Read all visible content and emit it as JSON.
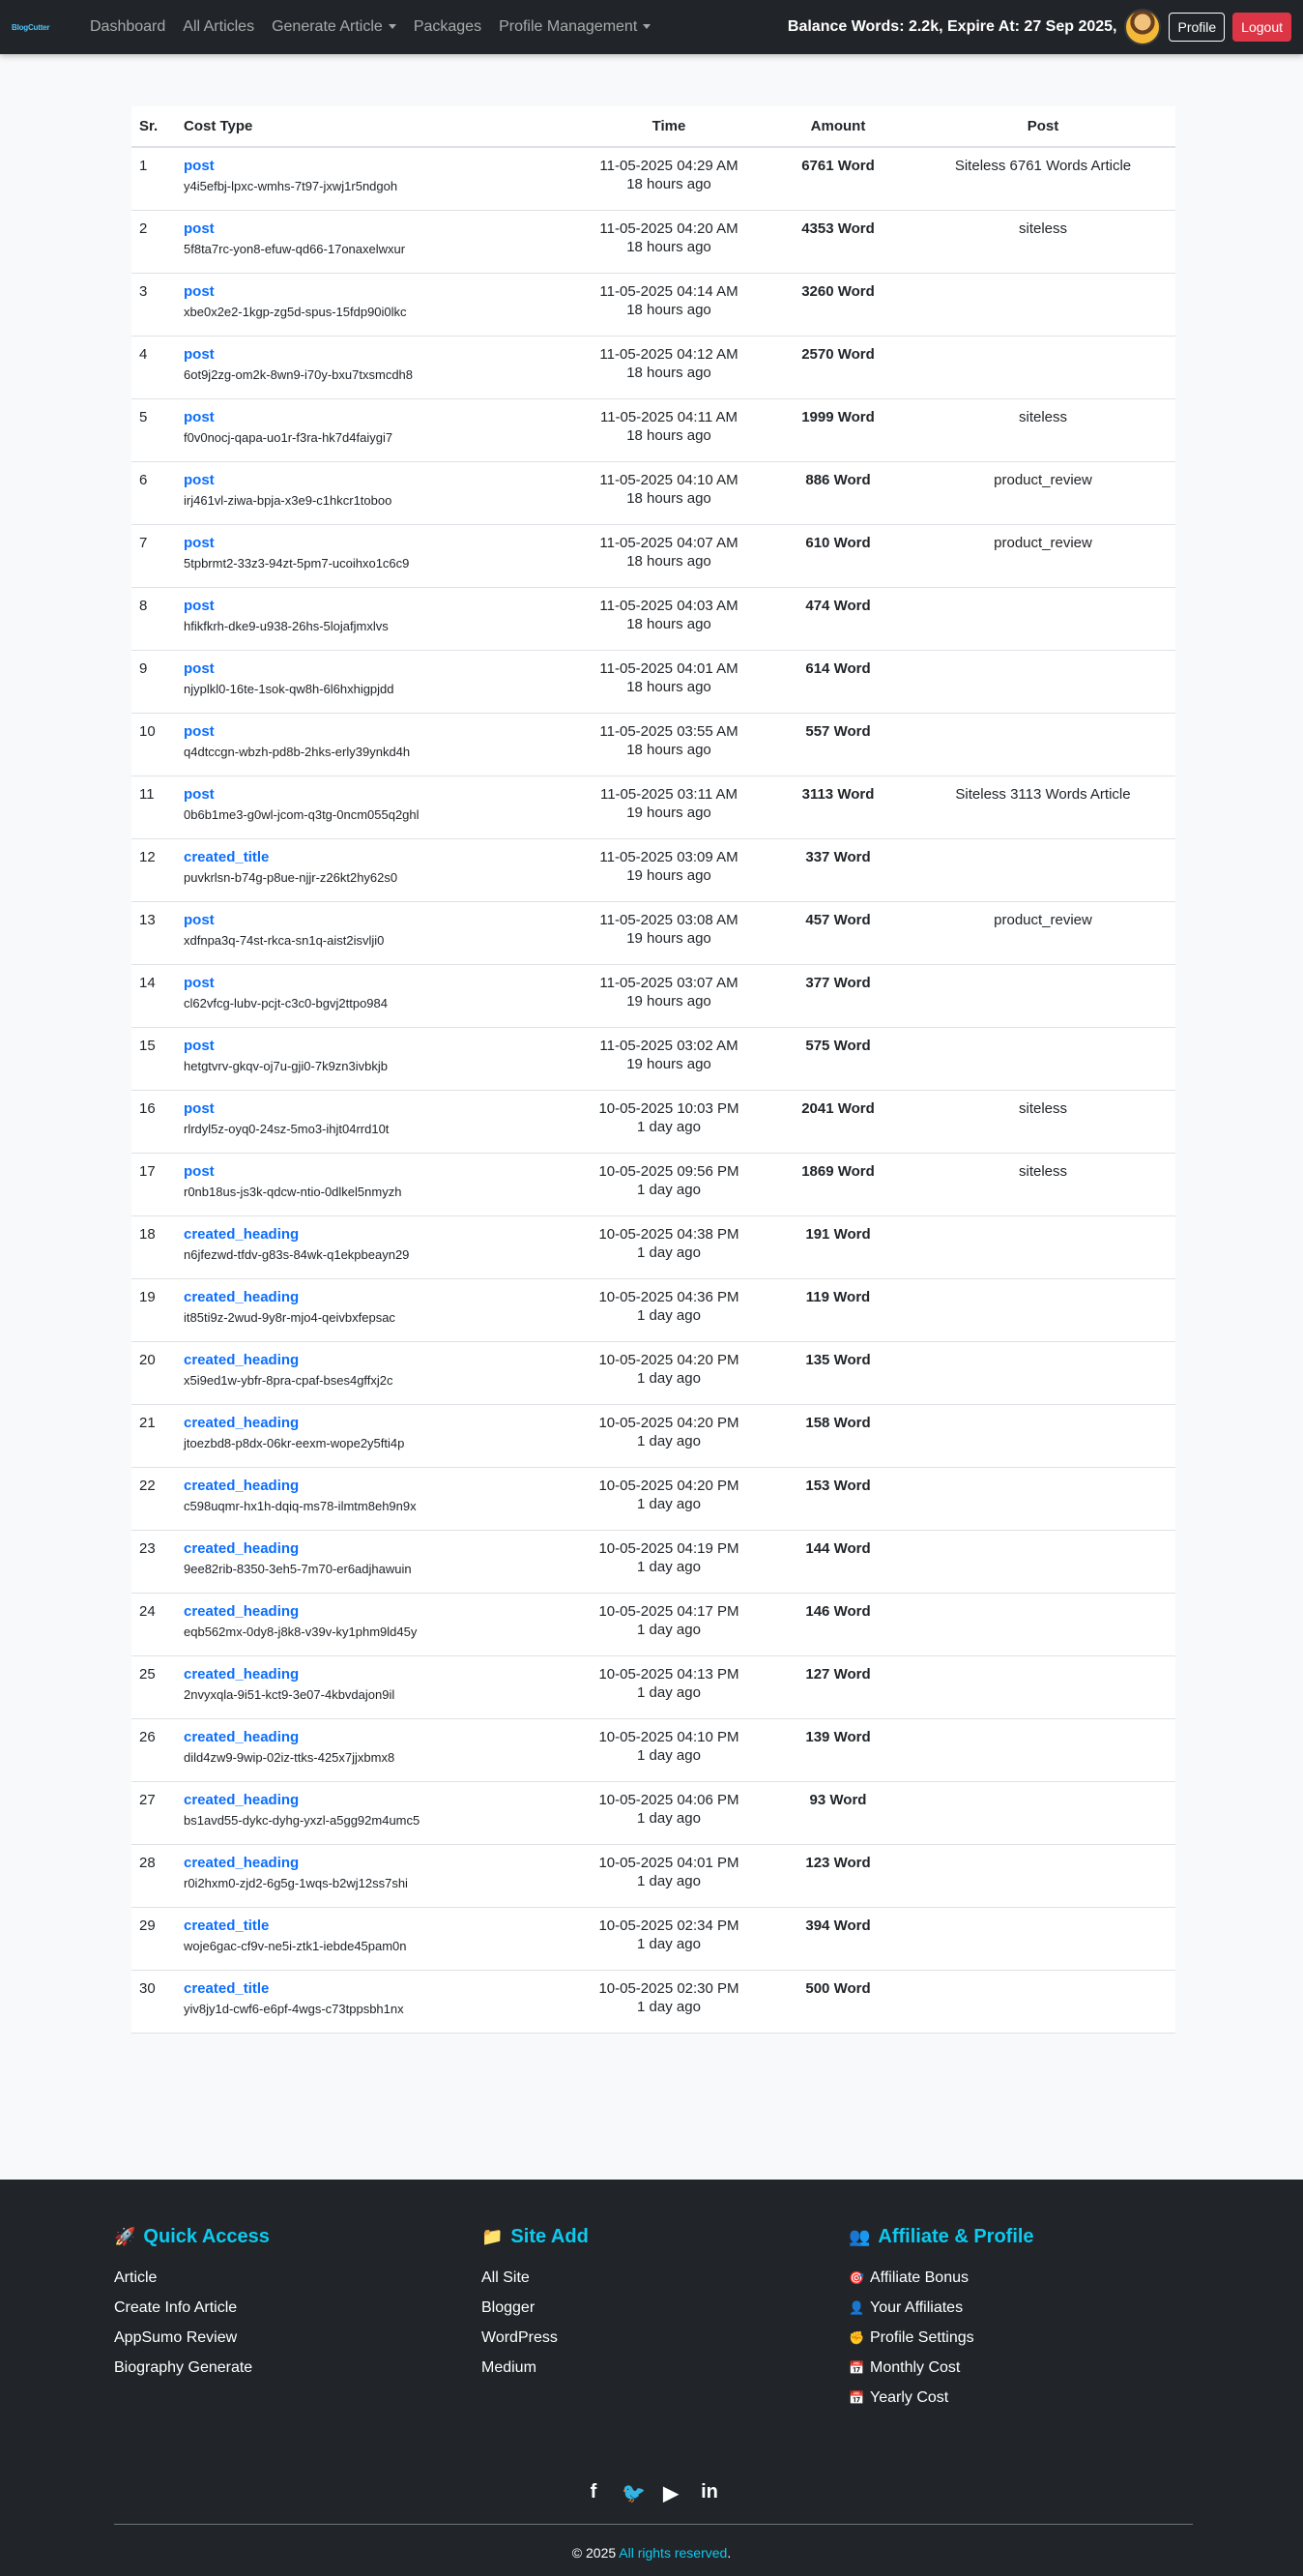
{
  "nav": {
    "brand": "BlogCutter",
    "links": [
      {
        "label": "Dashboard",
        "dropdown": false
      },
      {
        "label": "All Articles",
        "dropdown": false
      },
      {
        "label": "Generate Article",
        "dropdown": true
      },
      {
        "label": "Packages",
        "dropdown": false
      },
      {
        "label": "Profile Management",
        "dropdown": true
      }
    ],
    "balance": "Balance Words: 2.2k,  Expire At: 27 Sep 2025,",
    "profile_label": "Profile",
    "logout_label": "Logout"
  },
  "table": {
    "headers": {
      "sr": "Sr.",
      "type": "Cost Type",
      "time": "Time",
      "amount": "Amount",
      "post": "Post"
    },
    "rows": [
      {
        "sr": "1",
        "type": "post",
        "id": "y4i5efbj-lpxc-wmhs-7t97-jxwj1r5ndgoh",
        "time": "11-05-2025 04:29 AM",
        "ago": "18 hours ago",
        "amount": "6761 Word",
        "post": "Siteless 6761 Words Article"
      },
      {
        "sr": "2",
        "type": "post",
        "id": "5f8ta7rc-yon8-efuw-qd66-17onaxelwxur",
        "time": "11-05-2025 04:20 AM",
        "ago": "18 hours ago",
        "amount": "4353 Word",
        "post": "siteless"
      },
      {
        "sr": "3",
        "type": "post",
        "id": "xbe0x2e2-1kgp-zg5d-spus-15fdp90i0lkc",
        "time": "11-05-2025 04:14 AM",
        "ago": "18 hours ago",
        "amount": "3260 Word",
        "post": ""
      },
      {
        "sr": "4",
        "type": "post",
        "id": "6ot9j2zg-om2k-8wn9-i70y-bxu7txsmcdh8",
        "time": "11-05-2025 04:12 AM",
        "ago": "18 hours ago",
        "amount": "2570 Word",
        "post": ""
      },
      {
        "sr": "5",
        "type": "post",
        "id": "f0v0nocj-qapa-uo1r-f3ra-hk7d4faiygi7",
        "time": "11-05-2025 04:11 AM",
        "ago": "18 hours ago",
        "amount": "1999 Word",
        "post": "siteless"
      },
      {
        "sr": "6",
        "type": "post",
        "id": "irj461vl-ziwa-bpja-x3e9-c1hkcr1toboo",
        "time": "11-05-2025 04:10 AM",
        "ago": "18 hours ago",
        "amount": "886 Word",
        "post": "product_review"
      },
      {
        "sr": "7",
        "type": "post",
        "id": "5tpbrmt2-33z3-94zt-5pm7-ucoihxo1c6c9",
        "time": "11-05-2025 04:07 AM",
        "ago": "18 hours ago",
        "amount": "610 Word",
        "post": "product_review"
      },
      {
        "sr": "8",
        "type": "post",
        "id": "hfikfkrh-dke9-u938-26hs-5lojafjmxlvs",
        "time": "11-05-2025 04:03 AM",
        "ago": "18 hours ago",
        "amount": "474 Word",
        "post": ""
      },
      {
        "sr": "9",
        "type": "post",
        "id": "njyplkl0-16te-1sok-qw8h-6l6hxhigpjdd",
        "time": "11-05-2025 04:01 AM",
        "ago": "18 hours ago",
        "amount": "614 Word",
        "post": ""
      },
      {
        "sr": "10",
        "type": "post",
        "id": "q4dtccgn-wbzh-pd8b-2hks-erly39ynkd4h",
        "time": "11-05-2025 03:55 AM",
        "ago": "18 hours ago",
        "amount": "557 Word",
        "post": ""
      },
      {
        "sr": "11",
        "type": "post",
        "id": "0b6b1me3-g0wl-jcom-q3tg-0ncm055q2ghl",
        "time": "11-05-2025 03:11 AM",
        "ago": "19 hours ago",
        "amount": "3113 Word",
        "post": "Siteless 3113 Words Article"
      },
      {
        "sr": "12",
        "type": "created_title",
        "id": "puvkrlsn-b74g-p8ue-njjr-z26kt2hy62s0",
        "time": "11-05-2025 03:09 AM",
        "ago": "19 hours ago",
        "amount": "337 Word",
        "post": ""
      },
      {
        "sr": "13",
        "type": "post",
        "id": "xdfnpa3q-74st-rkca-sn1q-aist2isvlji0",
        "time": "11-05-2025 03:08 AM",
        "ago": "19 hours ago",
        "amount": "457 Word",
        "post": "product_review"
      },
      {
        "sr": "14",
        "type": "post",
        "id": "cl62vfcg-lubv-pcjt-c3c0-bgvj2ttpo984",
        "time": "11-05-2025 03:07 AM",
        "ago": "19 hours ago",
        "amount": "377 Word",
        "post": ""
      },
      {
        "sr": "15",
        "type": "post",
        "id": "hetgtvrv-gkqv-oj7u-gji0-7k9zn3ivbkjb",
        "time": "11-05-2025 03:02 AM",
        "ago": "19 hours ago",
        "amount": "575 Word",
        "post": ""
      },
      {
        "sr": "16",
        "type": "post",
        "id": "rlrdyl5z-oyq0-24sz-5mo3-ihjt04rrd10t",
        "time": "10-05-2025 10:03 PM",
        "ago": "1 day ago",
        "amount": "2041 Word",
        "post": "siteless"
      },
      {
        "sr": "17",
        "type": "post",
        "id": "r0nb18us-js3k-qdcw-ntio-0dlkel5nmyzh",
        "time": "10-05-2025 09:56 PM",
        "ago": "1 day ago",
        "amount": "1869 Word",
        "post": "siteless"
      },
      {
        "sr": "18",
        "type": "created_heading",
        "id": "n6jfezwd-tfdv-g83s-84wk-q1ekpbeayn29",
        "time": "10-05-2025 04:38 PM",
        "ago": "1 day ago",
        "amount": "191 Word",
        "post": ""
      },
      {
        "sr": "19",
        "type": "created_heading",
        "id": "it85ti9z-2wud-9y8r-mjo4-qeivbxfepsac",
        "time": "10-05-2025 04:36 PM",
        "ago": "1 day ago",
        "amount": "119 Word",
        "post": ""
      },
      {
        "sr": "20",
        "type": "created_heading",
        "id": "x5i9ed1w-ybfr-8pra-cpaf-bses4gffxj2c",
        "time": "10-05-2025 04:20 PM",
        "ago": "1 day ago",
        "amount": "135 Word",
        "post": ""
      },
      {
        "sr": "21",
        "type": "created_heading",
        "id": "jtoezbd8-p8dx-06kr-eexm-wope2y5fti4p",
        "time": "10-05-2025 04:20 PM",
        "ago": "1 day ago",
        "amount": "158 Word",
        "post": ""
      },
      {
        "sr": "22",
        "type": "created_heading",
        "id": "c598uqmr-hx1h-dqiq-ms78-ilmtm8eh9n9x",
        "time": "10-05-2025 04:20 PM",
        "ago": "1 day ago",
        "amount": "153 Word",
        "post": ""
      },
      {
        "sr": "23",
        "type": "created_heading",
        "id": "9ee82rib-8350-3eh5-7m70-er6adjhawuin",
        "time": "10-05-2025 04:19 PM",
        "ago": "1 day ago",
        "amount": "144 Word",
        "post": ""
      },
      {
        "sr": "24",
        "type": "created_heading",
        "id": "eqb562mx-0dy8-j8k8-v39v-ky1phm9ld45y",
        "time": "10-05-2025 04:17 PM",
        "ago": "1 day ago",
        "amount": "146 Word",
        "post": ""
      },
      {
        "sr": "25",
        "type": "created_heading",
        "id": "2nvyxqla-9i51-kct9-3e07-4kbvdajon9il",
        "time": "10-05-2025 04:13 PM",
        "ago": "1 day ago",
        "amount": "127 Word",
        "post": ""
      },
      {
        "sr": "26",
        "type": "created_heading",
        "id": "dild4zw9-9wip-02iz-ttks-425x7jjxbmx8",
        "time": "10-05-2025 04:10 PM",
        "ago": "1 day ago",
        "amount": "139 Word",
        "post": ""
      },
      {
        "sr": "27",
        "type": "created_heading",
        "id": "bs1avd55-dykc-dyhg-yxzl-a5gg92m4umc5",
        "time": "10-05-2025 04:06 PM",
        "ago": "1 day ago",
        "amount": "93 Word",
        "post": ""
      },
      {
        "sr": "28",
        "type": "created_heading",
        "id": "r0i2hxm0-zjd2-6g5g-1wqs-b2wj12ss7shi",
        "time": "10-05-2025 04:01 PM",
        "ago": "1 day ago",
        "amount": "123 Word",
        "post": ""
      },
      {
        "sr": "29",
        "type": "created_title",
        "id": "woje6gac-cf9v-ne5i-ztk1-iebde45pam0n",
        "time": "10-05-2025 02:34 PM",
        "ago": "1 day ago",
        "amount": "394 Word",
        "post": ""
      },
      {
        "sr": "30",
        "type": "created_title",
        "id": "yiv8jy1d-cwf6-e6pf-4wgs-c73tppsbh1nx",
        "time": "10-05-2025 02:30 PM",
        "ago": "1 day ago",
        "amount": "500 Word",
        "post": ""
      }
    ]
  },
  "footer": {
    "columns": [
      {
        "title": "Quick Access",
        "icon": "rocket-icon",
        "items": [
          {
            "label": "Article",
            "icon": ""
          },
          {
            "label": "Create Info Article",
            "icon": ""
          },
          {
            "label": "AppSumo Review",
            "icon": ""
          },
          {
            "label": "Biography Generate",
            "icon": ""
          }
        ]
      },
      {
        "title": "Site Add",
        "icon": "folder-icon",
        "items": [
          {
            "label": "All Site",
            "icon": ""
          },
          {
            "label": "Blogger",
            "icon": ""
          },
          {
            "label": "WordPress",
            "icon": ""
          },
          {
            "label": "Medium",
            "icon": ""
          }
        ]
      },
      {
        "title": "Affiliate & Profile",
        "icon": "people-icon",
        "items": [
          {
            "label": "Affiliate Bonus",
            "icon": "target-icon"
          },
          {
            "label": "Your Affiliates",
            "icon": "person-icon"
          },
          {
            "label": "Profile Settings",
            "icon": "hand-icon"
          },
          {
            "label": "Monthly Cost",
            "icon": "calendar-icon"
          },
          {
            "label": "Yearly Cost",
            "icon": "calendar-icon"
          }
        ]
      }
    ],
    "social": [
      "facebook-icon",
      "twitter-icon",
      "youtube-icon",
      "linkedin-icon"
    ],
    "copyright_prefix": "© 2025 ",
    "copyright_accent": "All rights reserved",
    "copyright_suffix": "."
  },
  "colors": {
    "accent": "#0d6efd",
    "footer_accent": "#0dcaf0",
    "logout": "#dc3545",
    "dark": "#212529"
  }
}
